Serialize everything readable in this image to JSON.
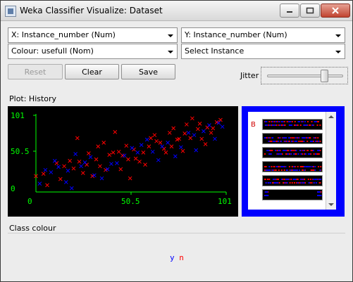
{
  "window": {
    "title": "Weka Classifier Visualize: Dataset",
    "icons": [
      "minimize-icon",
      "maximize-icon",
      "close-icon"
    ]
  },
  "controls": {
    "x_axis": "X: Instance_number (Num)",
    "y_axis": "Y: Instance_number (Num)",
    "colour": "Colour: usefull (Nom)",
    "select_instance": "Select Instance",
    "reset_label": "Reset",
    "clear_label": "Clear",
    "save_label": "Save",
    "jitter_label": "Jitter",
    "jitter_value": 0.78
  },
  "plot": {
    "label": "Plot: History",
    "axis_color": "#00ff00",
    "y_ticks": [
      "101",
      "50.5",
      "0"
    ],
    "x_ticks": [
      "0",
      "50.5",
      "101"
    ],
    "xlim": [
      0,
      101
    ],
    "ylim": [
      0,
      101
    ]
  },
  "matrix": {
    "label": "B",
    "rows": 6
  },
  "class_colour": {
    "label": "Class colour",
    "classes": [
      {
        "name": "y",
        "color": "#0000ff"
      },
      {
        "name": "n",
        "color": "#ff0000"
      }
    ]
  },
  "chart_data": {
    "type": "scatter",
    "title": "",
    "xlabel": "",
    "ylabel": "",
    "xlim": [
      0,
      101
    ],
    "ylim": [
      0,
      101
    ],
    "series": [
      {
        "name": "n",
        "color": "#ff0000",
        "points": [
          [
            0,
            21
          ],
          [
            4,
            24
          ],
          [
            6,
            9
          ],
          [
            11,
            38
          ],
          [
            13,
            17
          ],
          [
            15,
            34
          ],
          [
            18,
            41
          ],
          [
            20,
            31
          ],
          [
            22,
            71
          ],
          [
            23,
            40
          ],
          [
            25,
            25
          ],
          [
            27,
            36
          ],
          [
            28,
            51
          ],
          [
            30,
            21
          ],
          [
            32,
            43
          ],
          [
            33,
            60
          ],
          [
            34,
            34
          ],
          [
            36,
            65
          ],
          [
            37,
            29
          ],
          [
            39,
            49
          ],
          [
            41,
            52
          ],
          [
            42,
            79
          ],
          [
            44,
            53
          ],
          [
            45,
            30
          ],
          [
            46,
            48
          ],
          [
            48,
            61
          ],
          [
            49,
            43
          ],
          [
            50,
            18
          ],
          [
            52,
            56
          ],
          [
            53,
            44
          ],
          [
            55,
            40
          ],
          [
            57,
            52
          ],
          [
            58,
            36
          ],
          [
            60,
            60
          ],
          [
            61,
            71
          ],
          [
            63,
            75
          ],
          [
            64,
            67
          ],
          [
            66,
            65
          ],
          [
            68,
            57
          ],
          [
            69,
            52
          ],
          [
            71,
            78
          ],
          [
            72,
            60
          ],
          [
            73,
            84
          ],
          [
            75,
            69
          ],
          [
            76,
            70
          ],
          [
            78,
            54
          ],
          [
            79,
            77
          ],
          [
            80,
            89
          ],
          [
            82,
            71
          ],
          [
            83,
            97
          ],
          [
            86,
            83
          ],
          [
            87,
            90
          ],
          [
            88,
            70
          ],
          [
            90,
            63
          ],
          [
            91,
            85
          ],
          [
            93,
            78
          ],
          [
            94,
            84
          ],
          [
            96,
            92
          ],
          [
            98,
            95
          ]
        ]
      },
      {
        "name": "y",
        "color": "#0000ff",
        "points": [
          [
            2,
            11
          ],
          [
            5,
            29
          ],
          [
            8,
            26
          ],
          [
            10,
            41
          ],
          [
            12,
            33
          ],
          [
            16,
            13
          ],
          [
            17,
            28
          ],
          [
            19,
            5
          ],
          [
            21,
            50
          ],
          [
            24,
            34
          ],
          [
            26,
            39
          ],
          [
            29,
            46
          ],
          [
            31,
            22
          ],
          [
            35,
            18
          ],
          [
            38,
            30
          ],
          [
            40,
            37
          ],
          [
            43,
            38
          ],
          [
            47,
            48
          ],
          [
            51,
            58
          ],
          [
            54,
            52
          ],
          [
            56,
            62
          ],
          [
            59,
            69
          ],
          [
            62,
            53
          ],
          [
            65,
            42
          ],
          [
            67,
            60
          ],
          [
            70,
            65
          ],
          [
            74,
            47
          ],
          [
            77,
            59
          ],
          [
            81,
            78
          ],
          [
            84,
            75
          ],
          [
            85,
            55
          ],
          [
            89,
            80
          ],
          [
            92,
            88
          ],
          [
            95,
            70
          ],
          [
            97,
            91
          ],
          [
            99,
            86
          ]
        ]
      }
    ]
  }
}
